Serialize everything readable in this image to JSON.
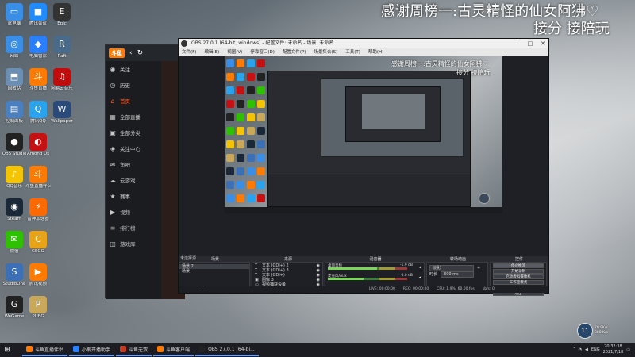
{
  "overlay": {
    "line1": "感谢周榜一:古灵精怪的仙女阿狒♡",
    "line2": "接分 接陪玩"
  },
  "desktop_icons": [
    {
      "label": "此电脑",
      "color": "#3a8ee6",
      "glyph": "▭"
    },
    {
      "label": "网络",
      "color": "#3a8ee6",
      "glyph": "◎"
    },
    {
      "label": "回收站",
      "color": "#6b8fb3",
      "glyph": "⬒"
    },
    {
      "label": "控制面板",
      "color": "#4a7fc0",
      "glyph": "▤"
    },
    {
      "label": "OBS Studio",
      "color": "#222222",
      "glyph": "●"
    },
    {
      "label": "QQ音乐",
      "color": "#f5c400",
      "glyph": "♪"
    },
    {
      "label": "Steam",
      "color": "#1b2838",
      "glyph": "◉"
    },
    {
      "label": "微信",
      "color": "#2dc100",
      "glyph": "✉"
    },
    {
      "label": "StudioOne",
      "color": "#3b6fb6",
      "glyph": "S"
    },
    {
      "label": "WeGame",
      "color": "#222222",
      "glyph": "G"
    },
    {
      "label": "腾讯会议",
      "color": "#1f8bff",
      "glyph": "■"
    },
    {
      "label": "电脑管家",
      "color": "#2a7fff",
      "glyph": "◆"
    },
    {
      "label": "斗鱼直播",
      "color": "#ff7a00",
      "glyph": "斗"
    },
    {
      "label": "腾讯QQ",
      "color": "#2aa3ef",
      "glyph": "Q"
    },
    {
      "label": "Among Us",
      "color": "#c51111",
      "glyph": "◐"
    },
    {
      "label": "斗鱼直播伴侣",
      "color": "#ff7a00",
      "glyph": "斗"
    },
    {
      "label": "雷神加速器",
      "color": "#ff6a00",
      "glyph": "⚡"
    },
    {
      "label": "CSGO",
      "color": "#e8a317",
      "glyph": "C"
    },
    {
      "label": "腾讯视频",
      "color": "#ff7a00",
      "glyph": "▶"
    },
    {
      "label": "PUBG",
      "color": "#caa85a",
      "glyph": "P"
    },
    {
      "label": "Epic",
      "color": "#333333",
      "glyph": "E"
    },
    {
      "label": "Raft",
      "color": "#4a6a8a",
      "glyph": "R"
    },
    {
      "label": "网易云音乐",
      "color": "#c20c0c",
      "glyph": "♫"
    },
    {
      "label": "Wallpaper",
      "color": "#2a4a7a",
      "glyph": "W"
    }
  ],
  "douyu": {
    "logo": "斗鱼",
    "menu": [
      {
        "icon": "◉",
        "label": "关注",
        "active": false
      },
      {
        "icon": "◷",
        "label": "历史",
        "active": false
      },
      {
        "icon": "⌂",
        "label": "首页",
        "active": true
      },
      {
        "icon": "▦",
        "label": "全部直播",
        "active": false
      },
      {
        "icon": "▣",
        "label": "全部分类",
        "active": false
      },
      {
        "icon": "◈",
        "label": "关注中心",
        "active": false
      },
      {
        "icon": "✉",
        "label": "鱼吧",
        "active": false
      },
      {
        "icon": "☁",
        "label": "云游戏",
        "active": false
      },
      {
        "icon": "★",
        "label": "赛事",
        "active": false
      },
      {
        "icon": "▶",
        "label": "视频",
        "active": false
      },
      {
        "icon": "≡",
        "label": "排行榜",
        "active": false
      },
      {
        "icon": "◫",
        "label": "游戏库",
        "active": false
      }
    ]
  },
  "obs": {
    "title": "OBS 27.0.1 (64-bit, windows) - 配置文件: 未命名 - 场景: 未命名",
    "menu": [
      "文件(F)",
      "编辑(E)",
      "视图(V)",
      "停靠窗口(D)",
      "配置文件(P)",
      "场景集合(S)",
      "工具(T)",
      "帮助(H)"
    ],
    "preview_overlay_line1": "感谢周榜一:古灵精怪的仙女阿狒♡",
    "preview_overlay_line2": "接分 接陪玩",
    "dock_titles": {
      "scenes": "场景",
      "sources": "来源",
      "mixer": "混音器",
      "transitions": "转场动画",
      "controls": "控件"
    },
    "scenes": [
      {
        "label": "场景 2",
        "selected": true
      },
      {
        "label": "场景",
        "selected": false
      }
    ],
    "sources": [
      {
        "icon": "T",
        "label": "文本 (GDI+) 2"
      },
      {
        "icon": "T",
        "label": "文本 (GDI+) 3"
      },
      {
        "icon": "T",
        "label": "文本 (GDI+)"
      },
      {
        "icon": "▣",
        "label": "图像 3"
      },
      {
        "icon": "▭",
        "label": "视频捕获设备"
      },
      {
        "icon": "▣",
        "label": "显示器采集"
      }
    ],
    "mixer": [
      {
        "label": "桌面音频",
        "db": "-1.9 dB"
      },
      {
        "label": "麦克风/Aux",
        "db": "0.0 dB"
      }
    ],
    "mixer_levels": [
      0.62,
      0.45
    ],
    "transition": {
      "type": "淡化",
      "duration_label": "时长",
      "duration_value": "300 ms"
    },
    "controls": [
      {
        "label": "停止推流",
        "active": true
      },
      {
        "label": "开始录制",
        "active": false
      },
      {
        "label": "启动虚拟摄像机",
        "active": false
      },
      {
        "label": "工作室模式",
        "active": false
      },
      {
        "label": "设置",
        "active": false
      },
      {
        "label": "退出",
        "active": false
      }
    ],
    "status": {
      "live": "LIVE: 00:00:00",
      "rec": "REC: 00:00:00",
      "cpu": "CPU: 1.9%, 60.00 fps",
      "kbps": "kb/s: 0"
    },
    "not_selected_label": "未选择源"
  },
  "taskbar": {
    "items": [
      {
        "label": "斗鱼直播伴侣",
        "color": "#ff7a00"
      },
      {
        "label": "小鹅开播助手",
        "color": "#2a7fff"
      },
      {
        "label": "斗鱼无双",
        "color": "#c23b22"
      },
      {
        "label": "斗鱼客户端",
        "color": "#ff7a00"
      },
      {
        "label": "OBS 27.0.1 (64-bi...",
        "color": "#222222"
      }
    ],
    "tray_lang": "ENG",
    "time": "20:32:38",
    "date": "2021/7/18"
  },
  "widget": {
    "value": "11",
    "stat1": "70.9K/s",
    "stat2": "380 K/s"
  }
}
